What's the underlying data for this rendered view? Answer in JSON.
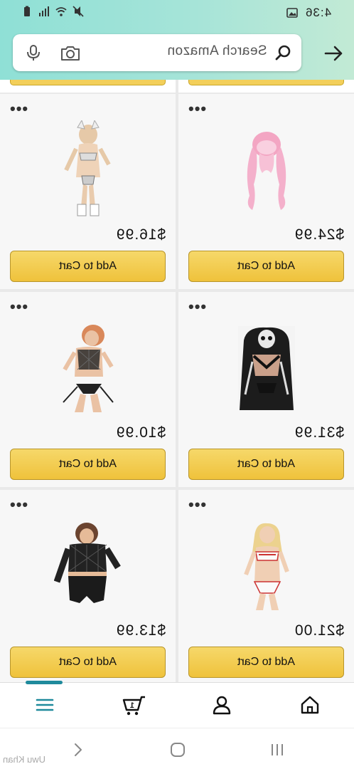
{
  "status_bar": {
    "time": "4:36",
    "icons": [
      "image-icon",
      "mute-icon",
      "wifi-icon",
      "signal-icon",
      "battery-icon"
    ]
  },
  "search": {
    "placeholder": "Search Amazon",
    "icons": [
      "mic-icon",
      "camera-icon",
      "search-icon"
    ],
    "back_icon": "arrow-right-icon"
  },
  "products": [
    {
      "price": "$16.99",
      "button": "Add to Cart",
      "image": "costume-figure"
    },
    {
      "price": "$24.99",
      "button": "Add to Cart",
      "image": "pink-wig"
    },
    {
      "price": "$10.99",
      "button": "Add to Cart",
      "image": "fishnet-set"
    },
    {
      "price": "$31.99",
      "button": "Add to Cart",
      "image": "skeleton-set"
    },
    {
      "price": "$13.99",
      "button": "Add to Cart",
      "image": "black-set"
    },
    {
      "price": "$21.00",
      "button": "Add to Cart",
      "image": "white-set"
    }
  ],
  "colors": {
    "button_yellow": "#efc23b",
    "accent_teal": "#1f8a9c",
    "header_gradient_start": "#8fe0d6",
    "header_gradient_end": "#c2ead5"
  },
  "tabs": [
    "menu-icon",
    "cart-icon",
    "account-icon",
    "home-icon"
  ],
  "navigation": [
    "back-icon",
    "home-button-icon",
    "recents-icon"
  ],
  "watermark": "Uwu Khan"
}
